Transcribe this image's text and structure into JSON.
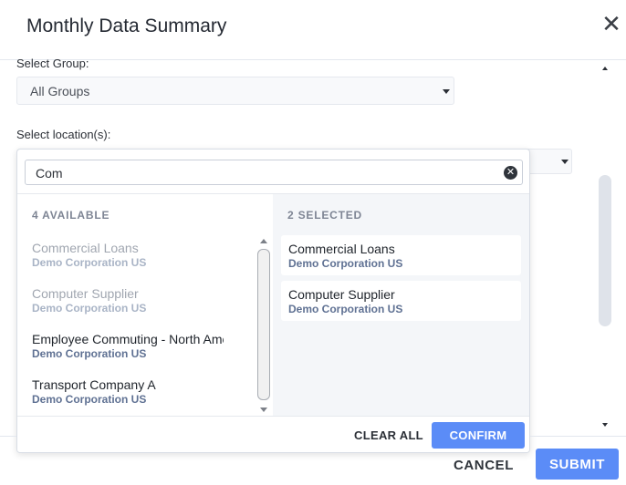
{
  "modal": {
    "title": "Monthly Data Summary",
    "close_icon": "close-icon",
    "close_glyph": "✕"
  },
  "group": {
    "label": "Select Group:",
    "value": "All Groups"
  },
  "location": {
    "label": "Select location(s):"
  },
  "dropdown": {
    "search_value": "Com",
    "clear_glyph": "✕",
    "available_heading": "4 AVAILABLE",
    "selected_heading": "2 SELECTED",
    "available_items": [
      {
        "title": "Commercial Loans",
        "subtitle": "Demo Corporation US",
        "state": "already-selected"
      },
      {
        "title": "Computer Supplier",
        "subtitle": "Demo Corporation US",
        "state": "already-selected"
      },
      {
        "title": "Employee Commuting - North America",
        "subtitle": "Demo Corporation US",
        "state": "available"
      },
      {
        "title": "Transport Company A",
        "subtitle": "Demo Corporation US",
        "state": "available"
      }
    ],
    "selected_items": [
      {
        "title": "Commercial Loans",
        "subtitle": "Demo Corporation US"
      },
      {
        "title": "Computer Supplier",
        "subtitle": "Demo Corporation US"
      }
    ],
    "clear_all_label": "CLEAR ALL",
    "confirm_label": "CONFIRM"
  },
  "footer": {
    "cancel_label": "CANCEL",
    "submit_label": "SUBMIT"
  },
  "colors": {
    "primary": "#5b8cf7",
    "muted_text": "#a0a6b0",
    "subtitle": "#5f7193",
    "selected_panel_bg": "#f4f6f9"
  }
}
